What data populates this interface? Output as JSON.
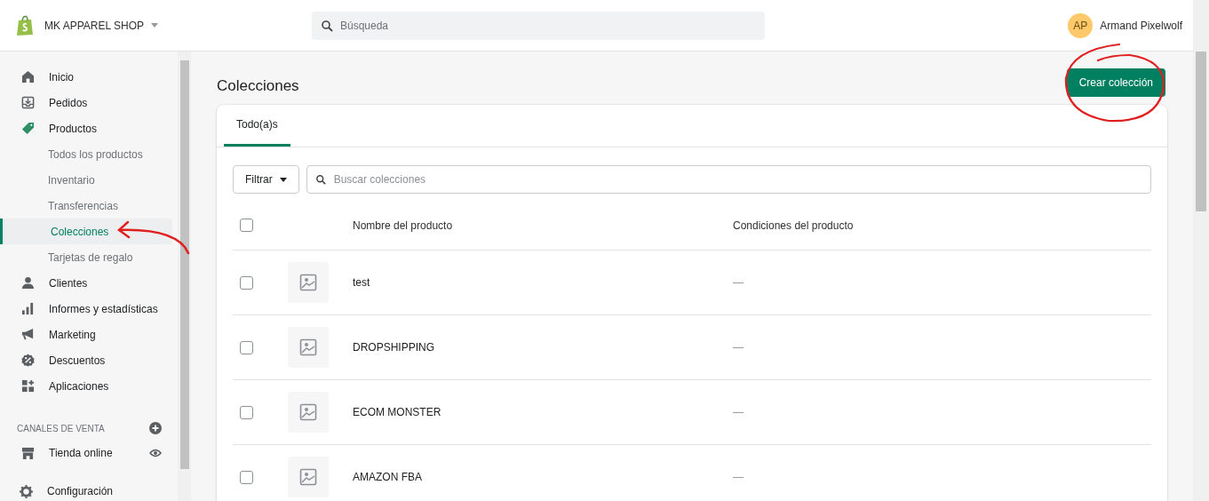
{
  "store": {
    "name": "MK APPAREL SHOP"
  },
  "search": {
    "placeholder": "Búsqueda"
  },
  "user": {
    "initials": "AP",
    "name": "Armand Pixelwolf"
  },
  "sidebar": {
    "items": [
      {
        "kind": "home",
        "label": "Inicio",
        "selected": false
      },
      {
        "kind": "orders",
        "label": "Pedidos",
        "selected": false
      },
      {
        "kind": "tag",
        "label": "Productos",
        "selected": false,
        "children": [
          {
            "label": "Todos los productos",
            "selected": false
          },
          {
            "label": "Inventario",
            "selected": false
          },
          {
            "label": "Transferencias",
            "selected": false
          },
          {
            "label": "Colecciones",
            "selected": true
          },
          {
            "label": "Tarjetas de regalo",
            "selected": false
          }
        ]
      },
      {
        "kind": "person",
        "label": "Clientes",
        "selected": false
      },
      {
        "kind": "chart",
        "label": "Informes y estadísticas",
        "selected": false
      },
      {
        "kind": "megaphone",
        "label": "Marketing",
        "selected": false
      },
      {
        "kind": "discount",
        "label": "Descuentos",
        "selected": false
      },
      {
        "kind": "apps",
        "label": "Aplicaciones",
        "selected": false
      }
    ],
    "channels_heading": "CANALES DE VENTA",
    "channels": [
      {
        "kind": "store",
        "label": "Tienda online"
      }
    ],
    "settings": {
      "label": "Configuración"
    }
  },
  "page": {
    "title": "Colecciones",
    "primary_button": "Crear colección"
  },
  "tabs": [
    {
      "label": "Todo(a)s",
      "selected": true
    }
  ],
  "filter": {
    "label": "Filtrar"
  },
  "collection_search": {
    "placeholder": "Buscar colecciones"
  },
  "table": {
    "select_all_checked": false,
    "columns": [
      "Nombre del producto",
      "Condiciones del producto"
    ],
    "rows": [
      {
        "checked": false,
        "name": "test",
        "conditions": "—"
      },
      {
        "checked": false,
        "name": "DROPSHIPPING",
        "conditions": "—"
      },
      {
        "checked": false,
        "name": "ECOM MONSTER",
        "conditions": "—"
      },
      {
        "checked": false,
        "name": "AMAZON FBA",
        "conditions": "—"
      }
    ]
  }
}
